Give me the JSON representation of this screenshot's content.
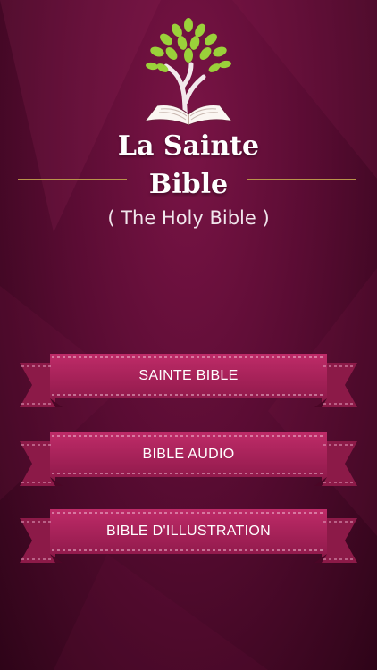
{
  "app": {
    "title_line1": "La Sainte",
    "title_line2": "Bible",
    "subtitle": "( The Holy Bible )"
  },
  "menu": {
    "items": [
      {
        "label": "SAINTE BIBLE"
      },
      {
        "label": "BIBLE AUDIO"
      },
      {
        "label": "BIBLE D'ILLUSTRATION"
      }
    ]
  },
  "colors": {
    "background": "#5a0c33",
    "ribbon_face": "#b0245f",
    "ribbon_fold": "#8c1a48",
    "accent_line": "#b8934a",
    "leaf_green": "#9ad13a"
  }
}
